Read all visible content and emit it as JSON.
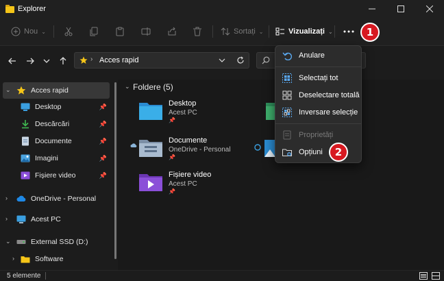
{
  "window": {
    "title": "Explorer"
  },
  "command_bar": {
    "new_label": "Nou",
    "sort_label": "Sortați",
    "view_label": "Vizualizați"
  },
  "address_bar": {
    "path": "Acces rapid"
  },
  "sidebar": {
    "items": [
      {
        "label": "Acces rapid"
      },
      {
        "label": "Desktop"
      },
      {
        "label": "Descărcări"
      },
      {
        "label": "Documente"
      },
      {
        "label": "Imagini"
      },
      {
        "label": "Fișiere video"
      },
      {
        "label": "OneDrive - Personal"
      },
      {
        "label": "Acest PC"
      },
      {
        "label": "External SSD (D:)"
      },
      {
        "label": "Software"
      }
    ]
  },
  "main": {
    "group_header": "Foldere (5)",
    "folders": [
      {
        "name": "Desktop",
        "location": "Acest PC"
      },
      {
        "name": "Documente",
        "location": "OneDrive - Personal"
      },
      {
        "name": "Fișiere video",
        "location": "Acest PC"
      }
    ]
  },
  "menu": {
    "items": [
      {
        "label": "Anulare"
      },
      {
        "label": "Selectați tot"
      },
      {
        "label": "Deselectare totală"
      },
      {
        "label": "Inversare selecție"
      },
      {
        "label": "Proprietăți"
      },
      {
        "label": "Opțiuni"
      }
    ]
  },
  "status_bar": {
    "item_count": "5 elemente"
  },
  "callouts": {
    "first": "1",
    "second": "2"
  },
  "colors": {
    "accent_yellow": "#f5c518",
    "callout_red": "#d71921",
    "folder_blue": "#3a9fe0"
  }
}
